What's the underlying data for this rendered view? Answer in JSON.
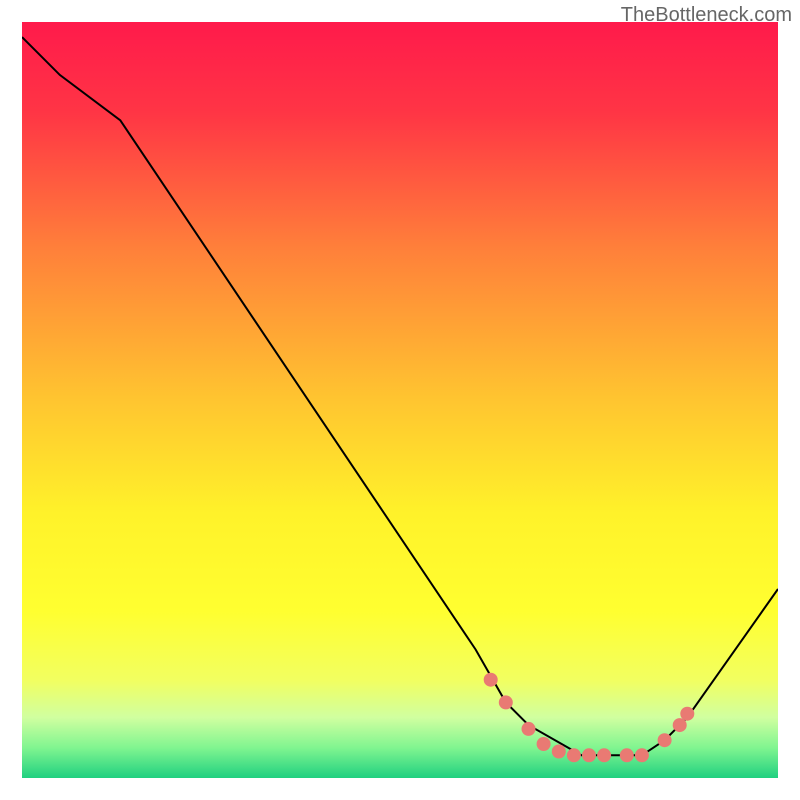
{
  "watermark": "TheBottleneck.com",
  "chart_data": {
    "type": "line",
    "title": "",
    "xlabel": "",
    "ylabel": "",
    "xlim": [
      0,
      100
    ],
    "ylim": [
      0,
      100
    ],
    "series": [
      {
        "name": "curve",
        "x": [
          0,
          5,
          13,
          60,
          64,
          67,
          74,
          82,
          85,
          88,
          100
        ],
        "y": [
          98,
          93,
          87,
          17,
          10,
          7,
          3,
          3,
          5,
          8,
          25
        ]
      }
    ],
    "markers": {
      "x": [
        62,
        64,
        67,
        69,
        71,
        73,
        75,
        77,
        80,
        82,
        85,
        87,
        88
      ],
      "y": [
        13,
        10,
        6.5,
        4.5,
        3.5,
        3,
        3,
        3,
        3,
        3,
        5,
        7,
        8.5
      ],
      "color": "#e97a73"
    },
    "gradient_stops": [
      {
        "offset": 0,
        "color": "#ff1a4b"
      },
      {
        "offset": 0.12,
        "color": "#ff3545"
      },
      {
        "offset": 0.3,
        "color": "#ff803a"
      },
      {
        "offset": 0.5,
        "color": "#ffc530"
      },
      {
        "offset": 0.65,
        "color": "#fff22a"
      },
      {
        "offset": 0.78,
        "color": "#ffff30"
      },
      {
        "offset": 0.87,
        "color": "#f2ff60"
      },
      {
        "offset": 0.92,
        "color": "#d0ffa0"
      },
      {
        "offset": 0.96,
        "color": "#80f590"
      },
      {
        "offset": 1.0,
        "color": "#20d080"
      }
    ]
  }
}
